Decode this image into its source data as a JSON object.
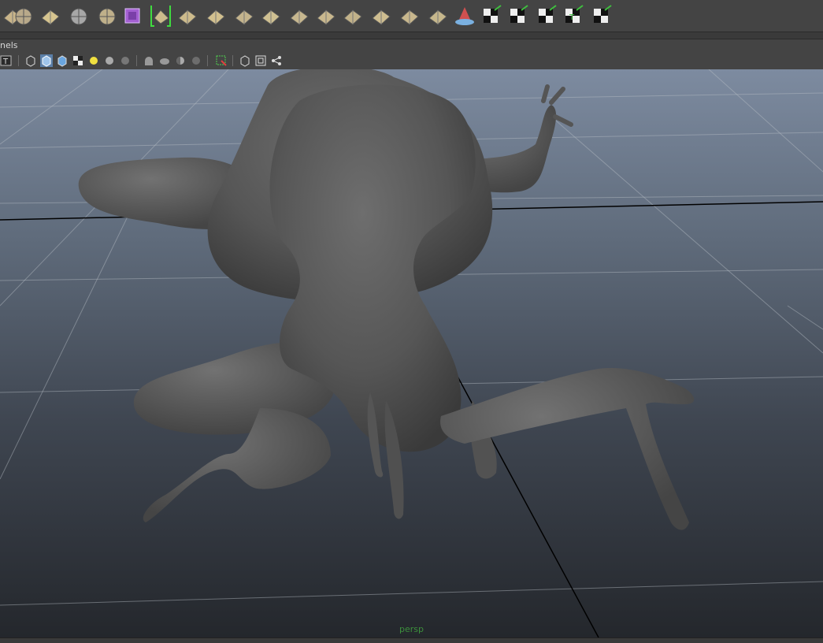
{
  "shelf": {
    "icons": [
      "uv-grid-icon",
      "uv-sphere-icon",
      "uv-move-icon",
      "globe-wire-icon",
      "globe-split-icon",
      "purple-cube-icon",
      "selected-plane-icon",
      "select-uv-icon",
      "box-map-icon",
      "split-uv-icon",
      "cube-uv-icon",
      "fold-uv-icon",
      "grid-uv-icon",
      "cut-uv-icon",
      "layout-uv-icon",
      "stack-uv-icon",
      "flat-uv-icon",
      "relax-cone-icon",
      "checker-arrow-icon",
      "checker-arrow-2-icon",
      "checker-arrow-3-icon",
      "checker-text-icon",
      "checker-grid-icon"
    ]
  },
  "panel_menu": {
    "label": "nels"
  },
  "panel_toolbar": {
    "icons": [
      "text-toggle-icon",
      "wireframe-cube-icon",
      "shaded-cube-icon",
      "textured-cube-icon",
      "checker-icon",
      "light-icon",
      "sphere-gray-icon",
      "sphere-dark-icon",
      "shadow-icon",
      "smooth-icon",
      "half-sphere-icon",
      "xray-icon",
      "isolate-select-icon",
      "grid-icon",
      "frame-icon",
      "share-icon"
    ]
  },
  "viewport": {
    "camera_label": "persp",
    "colors": {
      "camera_label": "#3c8f3c",
      "mesh": "#5a5a5a",
      "grid": "#b9bec6"
    }
  }
}
